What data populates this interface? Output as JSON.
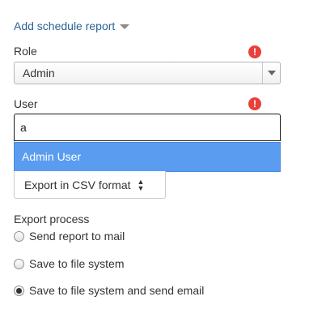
{
  "header": {
    "title": "Add schedule report"
  },
  "role": {
    "label": "Role",
    "required_icon": "exclamation-icon",
    "value": "Admin"
  },
  "user": {
    "label": "User",
    "required_icon": "exclamation-icon",
    "input_value": "a",
    "suggestion": "Admin User"
  },
  "export_format": {
    "value": "Export in CSV format"
  },
  "export_process": {
    "label": "Export process",
    "options": [
      {
        "label": "Send report to mail",
        "checked": false
      },
      {
        "label": "Save to file system",
        "checked": false
      },
      {
        "label": "Save to file system and send email",
        "checked": true
      }
    ]
  },
  "colors": {
    "link": "#2a6496",
    "required": "#e8413c",
    "highlight": "#5a9cf0"
  }
}
